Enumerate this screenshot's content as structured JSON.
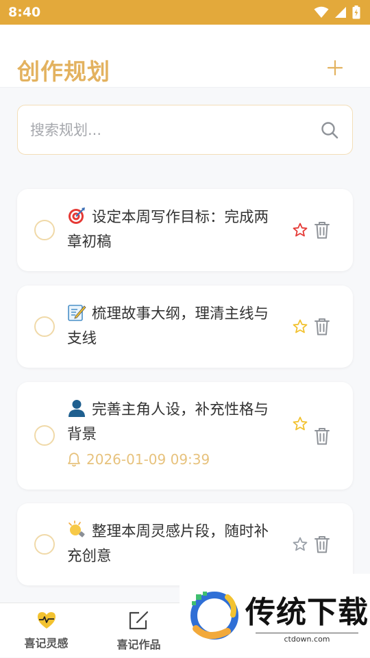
{
  "status_bar": {
    "time": "8:40"
  },
  "header": {
    "title": "创作规划",
    "add_label": "+"
  },
  "search": {
    "placeholder": "搜索规划..."
  },
  "tasks": [
    {
      "text": "设定本周写作目标：完成两章初稿",
      "emoji": "target-icon",
      "starred": true,
      "star_color": "#e53935"
    },
    {
      "text": "梳理故事大纲，理清主线与支线",
      "emoji": "memo-icon",
      "starred": true,
      "star_color": "#f2c230"
    },
    {
      "text": "完善主角人设，补充性格与背景",
      "emoji": "person-icon",
      "starred": true,
      "star_color": "#f2c230",
      "reminder": "2026-01-09 09:39"
    },
    {
      "text": "整理本周灵感片段，随时补充创意",
      "emoji": "lightbulb-icon",
      "starred": false,
      "star_color": "#9aa0a8"
    }
  ],
  "nav": [
    {
      "label": "喜记灵感"
    },
    {
      "label": "喜记作品"
    }
  ],
  "watermark": {
    "brand": "传统下载",
    "domain": "ctdown.com"
  },
  "colors": {
    "accent": "#e3a93b",
    "title": "#e3b25f",
    "circle": "#f0d9a8",
    "reminder": "#e7c27d"
  }
}
